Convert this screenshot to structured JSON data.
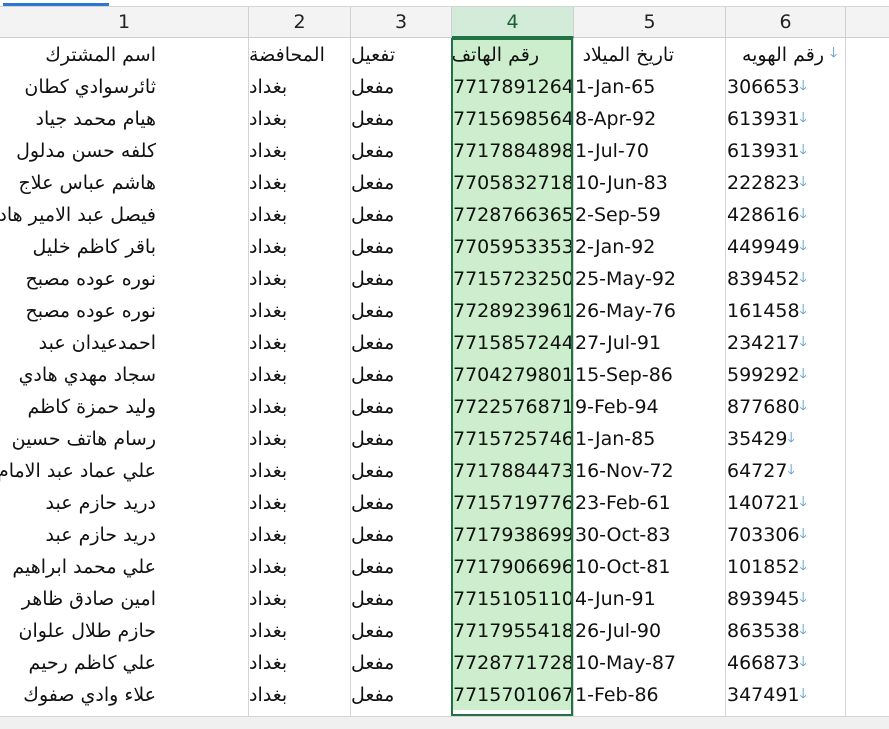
{
  "column_headers": [
    "1",
    "2",
    "3",
    "4",
    "5",
    "6"
  ],
  "field_labels": {
    "name": "اسم المشترك",
    "province": "المحافضة",
    "activation": "تفعيل",
    "phone": "رقم الهاتف",
    "birth": "تاريخ الميلاد",
    "id": "رقم الهويه"
  },
  "icons": {
    "filter": "filter-arrow-icon"
  },
  "colors": {
    "selection_fill": "#cdeecd",
    "selection_border": "#217346",
    "arrow": "#4f8fd6",
    "tab_accent": "#2b78d4"
  },
  "rows": [
    {
      "name": "ثائرسوادي كطان",
      "province": "بغداد",
      "activation": "مفعل",
      "phone": "7717891264",
      "birth": "1-Jan-65",
      "id": "306653"
    },
    {
      "name": "هيام محمد جياد",
      "province": "بغداد",
      "activation": "مفعل",
      "phone": "7715698564",
      "birth": "8-Apr-92",
      "id": "613931"
    },
    {
      "name": "كلفه حسن مدلول",
      "province": "بغداد",
      "activation": "مفعل",
      "phone": "7717884898",
      "birth": "1-Jul-70",
      "id": "613931"
    },
    {
      "name": "هاشم عباس علاج",
      "province": "بغداد",
      "activation": "مفعل",
      "phone": "7705832718",
      "birth": "10-Jun-83",
      "id": "222823"
    },
    {
      "name": "فيصل عبد الامير هادي",
      "province": "بغداد",
      "activation": "مفعل",
      "phone": "7728766365",
      "birth": "2-Sep-59",
      "id": "428616"
    },
    {
      "name": "باقر كاظم خليل",
      "province": "بغداد",
      "activation": "مفعل",
      "phone": "7705953353",
      "birth": "2-Jan-92",
      "id": "449949"
    },
    {
      "name": "نوره عوده مصبح",
      "province": "بغداد",
      "activation": "مفعل",
      "phone": "7715723250",
      "birth": "25-May-92",
      "id": "839452"
    },
    {
      "name": "نوره عوده مصبح",
      "province": "بغداد",
      "activation": "مفعل",
      "phone": "7728923961",
      "birth": "26-May-76",
      "id": "161458"
    },
    {
      "name": "احمدعيدان عبد",
      "province": "بغداد",
      "activation": "مفعل",
      "phone": "7715857244",
      "birth": "27-Jul-91",
      "id": "234217"
    },
    {
      "name": "سجاد مهدي هادي",
      "province": "بغداد",
      "activation": "مفعل",
      "phone": "7704279801",
      "birth": "15-Sep-86",
      "id": "599292"
    },
    {
      "name": "وليد حمزة كاظم",
      "province": "بغداد",
      "activation": "مفعل",
      "phone": "7722576871",
      "birth": "9-Feb-94",
      "id": "877680"
    },
    {
      "name": "رسام هاتف حسين",
      "province": "بغداد",
      "activation": "مفعل",
      "phone": "7715725746",
      "birth": "1-Jan-85",
      "id": "35429"
    },
    {
      "name": "علي عماد عبد الامام",
      "province": "بغداد",
      "activation": "مفعل",
      "phone": "7717884473",
      "birth": "16-Nov-72",
      "id": "64727"
    },
    {
      "name": "دريد حازم عبد",
      "province": "بغداد",
      "activation": "مفعل",
      "phone": "7715719776",
      "birth": "23-Feb-61",
      "id": "140721"
    },
    {
      "name": "دريد حازم عبد",
      "province": "بغداد",
      "activation": "مفعل",
      "phone": "7717938699",
      "birth": "30-Oct-83",
      "id": "703306"
    },
    {
      "name": "علي محمد ابراهيم",
      "province": "بغداد",
      "activation": "مفعل",
      "phone": "7717906696",
      "birth": "10-Oct-81",
      "id": "101852"
    },
    {
      "name": "امين صادق ظاهر",
      "province": "بغداد",
      "activation": "مفعل",
      "phone": "7715105110",
      "birth": "4-Jun-91",
      "id": "893945"
    },
    {
      "name": "حازم طلال علوان",
      "province": "بغداد",
      "activation": "مفعل",
      "phone": "7717955418",
      "birth": "26-Jul-90",
      "id": "863538"
    },
    {
      "name": "علي كاظم رحيم",
      "province": "بغداد",
      "activation": "مفعل",
      "phone": "7728771728",
      "birth": "10-May-87",
      "id": "466873"
    },
    {
      "name": "علاء وادي صفوك",
      "province": "بغداد",
      "activation": "مفعل",
      "phone": "7715701067",
      "birth": "1-Feb-86",
      "id": "347491"
    }
  ]
}
